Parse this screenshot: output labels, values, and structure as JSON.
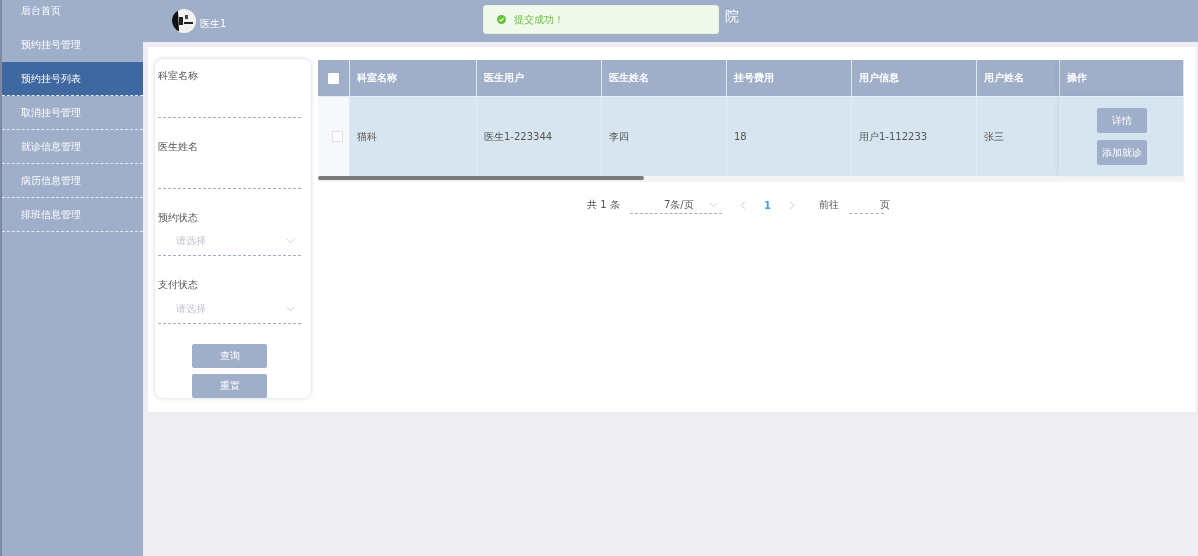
{
  "sidebar": {
    "items": [
      {
        "label": "后台首页",
        "selected": false
      },
      {
        "label": "预约挂号管理",
        "selected": false
      },
      {
        "label": "预约挂号列表",
        "selected": true
      },
      {
        "label": "取消挂号管理",
        "selected": false
      },
      {
        "label": "就诊信息管理",
        "selected": false
      },
      {
        "label": "病历信息管理",
        "selected": false
      },
      {
        "label": "排班信息管理",
        "selected": false
      }
    ]
  },
  "header": {
    "user": "医生1",
    "title": "院"
  },
  "toast": {
    "message": "提交成功！"
  },
  "filters": [
    {
      "kind": "input",
      "label": "科室名称"
    },
    {
      "kind": "input",
      "label": "医生姓名"
    },
    {
      "kind": "select",
      "label": "预约状态",
      "placeholder": "请选择"
    },
    {
      "kind": "select",
      "label": "支付状态",
      "placeholder": "请选择"
    }
  ],
  "filter_buttons": [
    "查询",
    "重置"
  ],
  "table": {
    "header_checked": false,
    "columns": [
      "科室名称",
      "医生用户",
      "医生姓名",
      "挂号费用",
      "用户信息",
      "用户姓名",
      "操作"
    ],
    "rows": [
      {
        "selected": false,
        "cells": [
          "猫科",
          "医生1-223344",
          "李四",
          "18",
          "用户1-112233",
          "张三"
        ],
        "actions": [
          "详情",
          "添加就诊"
        ]
      }
    ]
  },
  "pagination": {
    "total": "共 1 条",
    "page_size": "7条/页",
    "pages": [
      {
        "label": "1",
        "selected": true
      }
    ],
    "goto": "前往",
    "goto_suffix": "页"
  }
}
